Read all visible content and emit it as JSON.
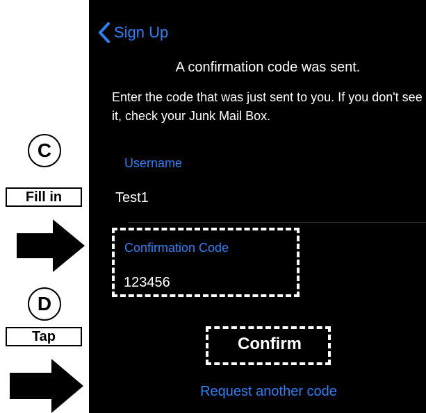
{
  "screen": {
    "background": "#000000",
    "accent_color": "#2f80f6",
    "back_label": "Sign Up",
    "headline": "A confirmation code was sent.",
    "instructions": "Enter the code that was just sent to you.  If you don't see it, check your Junk Mail Box.",
    "username": {
      "label": "Username",
      "value": "Test1"
    },
    "confirmation_code": {
      "label": "Confirmation Code",
      "value": "123456"
    },
    "confirm_label": "Confirm",
    "request_label": "Request another code"
  },
  "annotations": {
    "step_c": {
      "letter": "C",
      "action": "Fill in"
    },
    "step_d": {
      "letter": "D",
      "action": "Tap"
    }
  }
}
